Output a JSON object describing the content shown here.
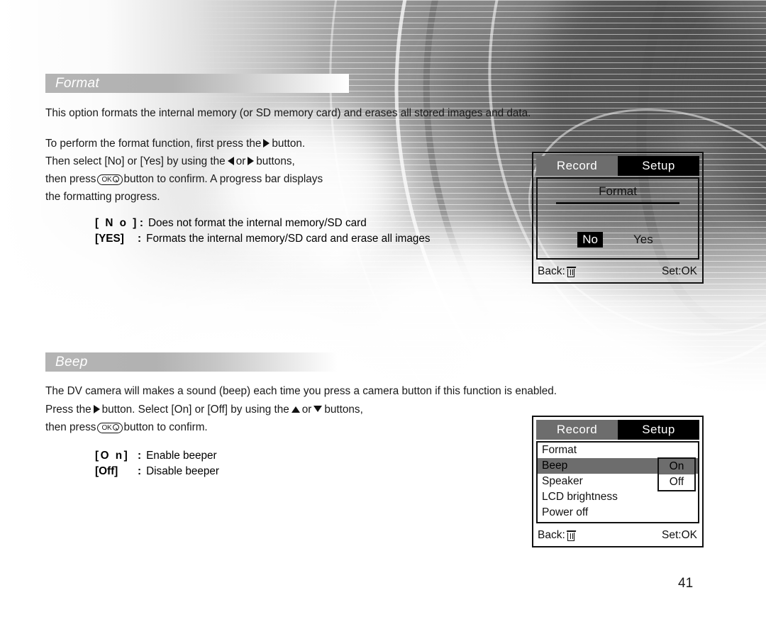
{
  "page": {
    "number": "41"
  },
  "sections": [
    {
      "id": "format",
      "heading": "Format",
      "intro": "This option formats the internal memory (or SD memory card) and erases all stored images and data.",
      "steps": {
        "line1_a": "To perform the format function, first press the",
        "line1_b": "button.",
        "line2_a": "Then select [No] or [Yes] by using the",
        "line2_b": "or",
        "line2_c": "buttons,",
        "line3_a": "then press",
        "line3_b": "button to confirm. A progress bar displays",
        "line4": "the formatting progress."
      },
      "options": [
        {
          "key": "[ N o ]",
          "colon": ":",
          "desc": "Does not format the internal memory/SD card"
        },
        {
          "key": "[YES]",
          "colon": ":",
          "desc": "Formats the internal memory/SD card and erase all images"
        }
      ],
      "screen": {
        "tabs": [
          {
            "label": "Record",
            "active": false
          },
          {
            "label": "Setup",
            "active": true
          }
        ],
        "title": "Format",
        "choices": [
          {
            "label": "No",
            "selected": true
          },
          {
            "label": "Yes",
            "selected": false
          }
        ],
        "footer_left_label": "Back:",
        "footer_left_icon": "trash-icon",
        "footer_right_label": "Set:OK"
      }
    },
    {
      "id": "beep",
      "heading": "Beep",
      "intro": "The DV camera will makes a sound (beep) each time you press a camera button if this function is enabled.",
      "steps": {
        "line1_a": "Press the",
        "line1_b": "button. Select [On] or [Off] by using the",
        "line1_c": "or",
        "line1_d": "buttons,",
        "line2_a": "then press",
        "line2_b": "button to confirm."
      },
      "options": [
        {
          "key": "[O n]",
          "colon": ":",
          "desc": "Enable beeper"
        },
        {
          "key": "[Off]",
          "colon": ":",
          "desc": "Disable beeper"
        }
      ],
      "screen": {
        "tabs": [
          {
            "label": "Record",
            "active": false
          },
          {
            "label": "Setup",
            "active": true
          }
        ],
        "menu": [
          {
            "label": "Format",
            "selected": false
          },
          {
            "label": "Beep",
            "selected": true
          },
          {
            "label": "Speaker",
            "selected": false
          },
          {
            "label": "LCD brightness",
            "selected": false
          },
          {
            "label": "Power off",
            "selected": false
          }
        ],
        "submenu": [
          {
            "label": "On",
            "selected": true
          },
          {
            "label": "Off",
            "selected": false
          }
        ],
        "footer_left_label": "Back:",
        "footer_left_icon": "trash-icon",
        "footer_right_label": "Set:OK"
      }
    }
  ],
  "colors": {
    "tab_inactive": "#6d6d6d",
    "tab_active": "#000000",
    "highlight": "#6d6d6d",
    "selection_invert_bg": "#000000",
    "bar_gradient_start": "#b4b4b4",
    "bar_gradient_end": "#ffffff",
    "text": "#1a1a1a"
  }
}
